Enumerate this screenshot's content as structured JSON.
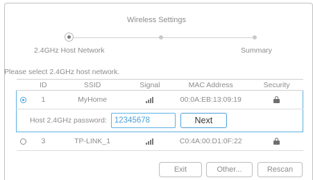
{
  "title": "Wireless Settings",
  "steps": [
    {
      "label": "2.4GHz Host Network",
      "state": "current"
    },
    {
      "label": "",
      "state": "pending"
    },
    {
      "label": "Summary",
      "state": "pending"
    }
  ],
  "instruction": "Please select 2.4GHz host network.",
  "table": {
    "headers": {
      "id": "ID",
      "ssid": "SSID",
      "signal": "Signal",
      "mac": "MAC Address",
      "security": "Security"
    },
    "rows": [
      {
        "selected": true,
        "id": "1",
        "ssid": "MyHome",
        "signal_icon": "signal-strong-icon",
        "mac": "00:0A:EB:13:09:19",
        "security_icon": "lock-icon"
      },
      {
        "selected": false,
        "id": "3",
        "ssid": "TP-LINK_1",
        "signal_icon": "signal-strong-icon",
        "mac": "C0:4A:00:D1:0F:22",
        "security_icon": "lock-icon"
      }
    ]
  },
  "password": {
    "label": "Host 2.4GHz password:",
    "value": "12345678",
    "next_label": "Next"
  },
  "buttons": {
    "exit": "Exit",
    "other": "Other...",
    "rescan": "Rescan"
  },
  "colors": {
    "accent": "#4a9fd8",
    "text": "#8c8c8c"
  }
}
